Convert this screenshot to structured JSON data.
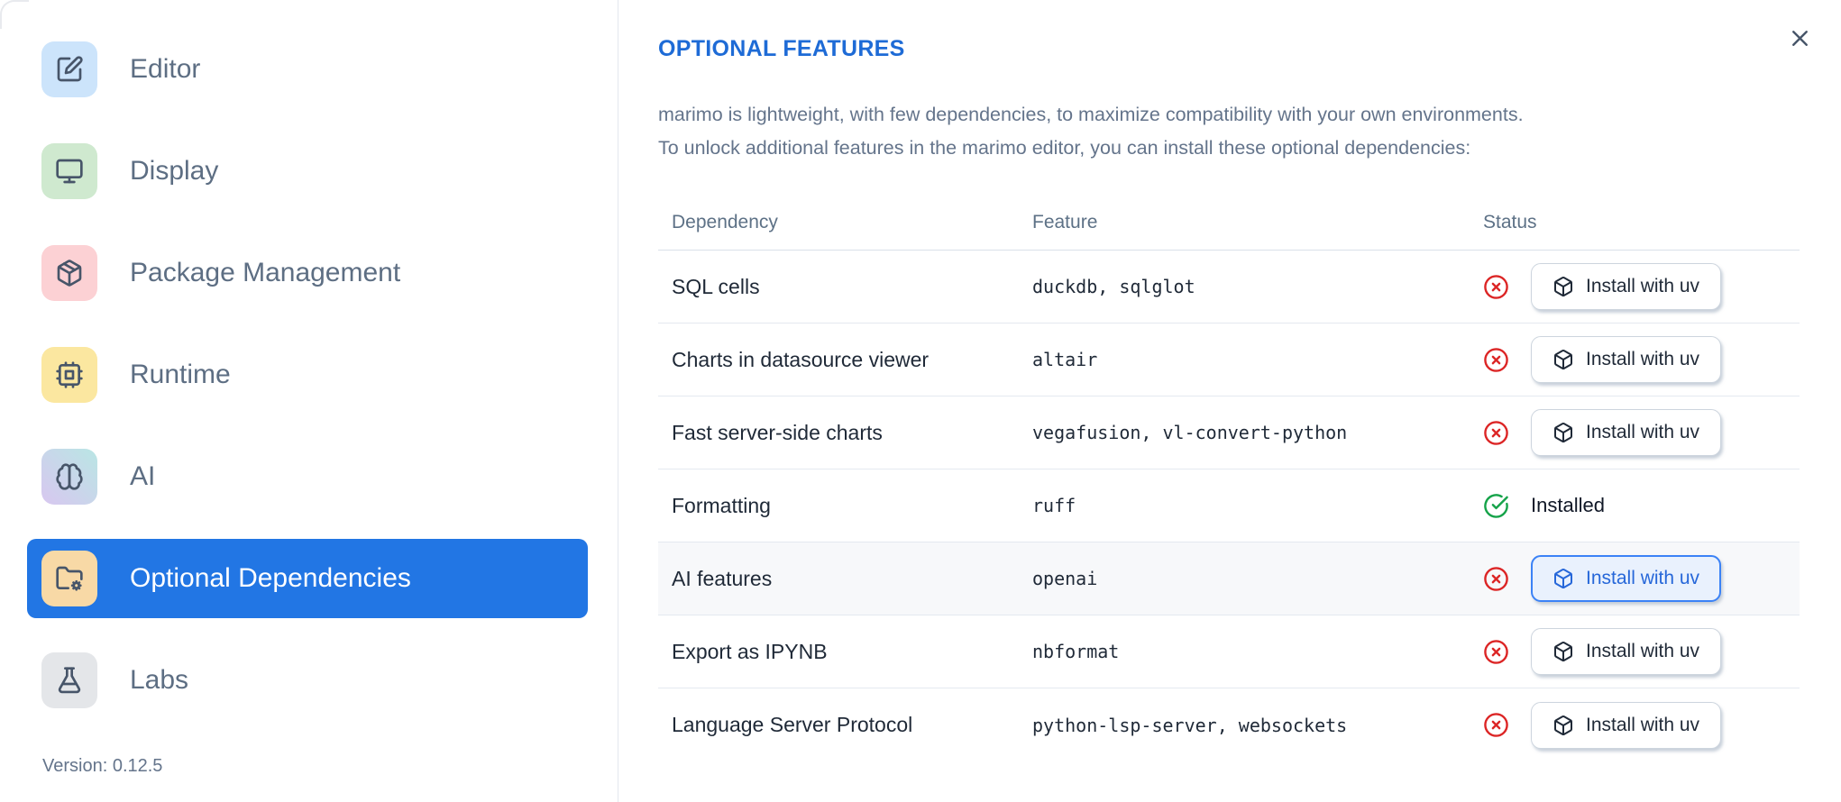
{
  "sidebar": {
    "items": [
      {
        "label": "Editor",
        "icon": "edit-icon",
        "icon_bg": "#cce4fb"
      },
      {
        "label": "Display",
        "icon": "monitor-icon",
        "icon_bg": "#cfe9cf"
      },
      {
        "label": "Package Management",
        "icon": "package-icon",
        "icon_bg": "#fcd1d4"
      },
      {
        "label": "Runtime",
        "icon": "cpu-icon",
        "icon_bg": "#fbe7a0"
      },
      {
        "label": "AI",
        "icon": "brain-icon",
        "icon_bg": "#b9e6e4",
        "icon_bg2": "#d8c7f0"
      },
      {
        "label": "Optional Dependencies",
        "icon": "folder-cog-icon",
        "icon_bg": "#f8d9a6",
        "active": true
      },
      {
        "label": "Labs",
        "icon": "flask-icon",
        "icon_bg": "#e4e6e9"
      }
    ],
    "version": "Version: 0.12.5"
  },
  "header": {
    "title": "OPTIONAL FEATURES",
    "close_icon": "close-icon"
  },
  "intro": {
    "line1": "marimo is lightweight, with few dependencies, to maximize compatibility with your own environments.",
    "line2": "To unlock additional features in the marimo editor, you can install these optional dependencies:"
  },
  "table": {
    "headers": [
      "Dependency",
      "Feature",
      "Status"
    ],
    "install_button_label": "Install with uv",
    "install_button_icon": "box-icon",
    "installed_label": "Installed",
    "missing_icon": "circle-x-icon",
    "installed_icon": "circle-check-icon",
    "rows": [
      {
        "dependency": "SQL cells",
        "feature": "duckdb, sqlglot",
        "installed": false
      },
      {
        "dependency": "Charts in datasource viewer",
        "feature": "altair",
        "installed": false
      },
      {
        "dependency": "Fast server-side charts",
        "feature": "vegafusion, vl-convert-python",
        "installed": false
      },
      {
        "dependency": "Formatting",
        "feature": "ruff",
        "installed": true
      },
      {
        "dependency": "AI features",
        "feature": "openai",
        "installed": false,
        "highlighted": true,
        "button_focused": true
      },
      {
        "dependency": "Export as IPYNB",
        "feature": "nbformat",
        "installed": false
      },
      {
        "dependency": "Language Server Protocol",
        "feature": "python-lsp-server, websockets",
        "installed": false
      }
    ]
  },
  "colors": {
    "accent_blue": "#2276e4",
    "title_blue": "#1e6bd6",
    "error_red": "#dc2626",
    "success_green": "#16a34a",
    "focus_border": "#3b82f6",
    "focus_bg": "#e9f1fd",
    "focus_text": "#2667d9"
  }
}
